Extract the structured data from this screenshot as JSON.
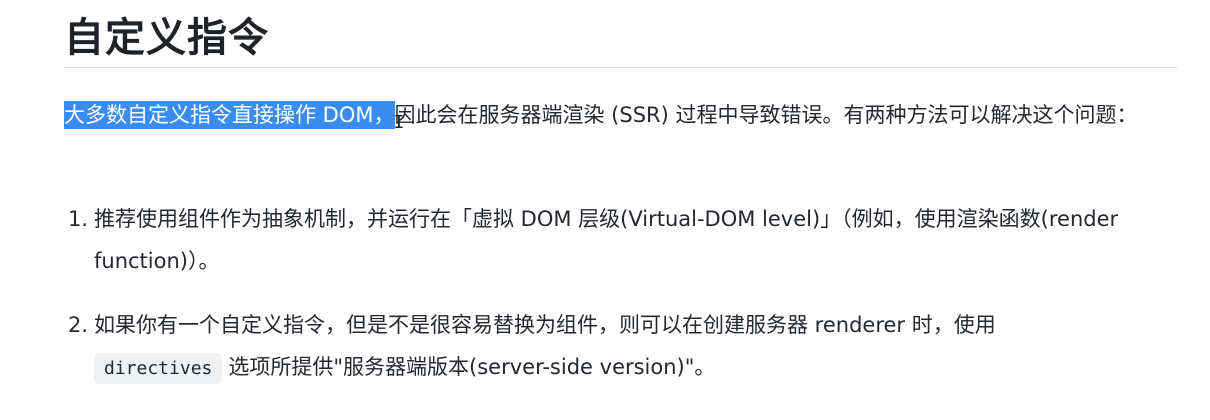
{
  "doc": {
    "heading": "自定义指令",
    "para": {
      "highlighted": "大多数自定义指令直接操作 DOM，",
      "cursor_glyph": "I",
      "rest": "因此会在服务器端渲染 (SSR) 过程中导致错误。有两种方法可以解决这个问题："
    },
    "list": [
      {
        "num": "1.",
        "text": "推荐使用组件作为抽象机制，并运行在「虚拟 DOM 层级(Virtual-DOM level)」（例如，使用渲染函数(render function)）。"
      },
      {
        "num": "2.",
        "text_before": "如果你有一个自定义指令，但是不是很容易替换为组件，则可以在创建服务器 renderer 时，使用 ",
        "code": "directives",
        "text_after": "选项所提供\"服务器端版本(server-side version)\"。"
      }
    ],
    "colors": {
      "selection": "#3b8cf0",
      "text": "#24292f",
      "code_bg": "#eff1f3",
      "divider": "#d8dee4"
    }
  }
}
